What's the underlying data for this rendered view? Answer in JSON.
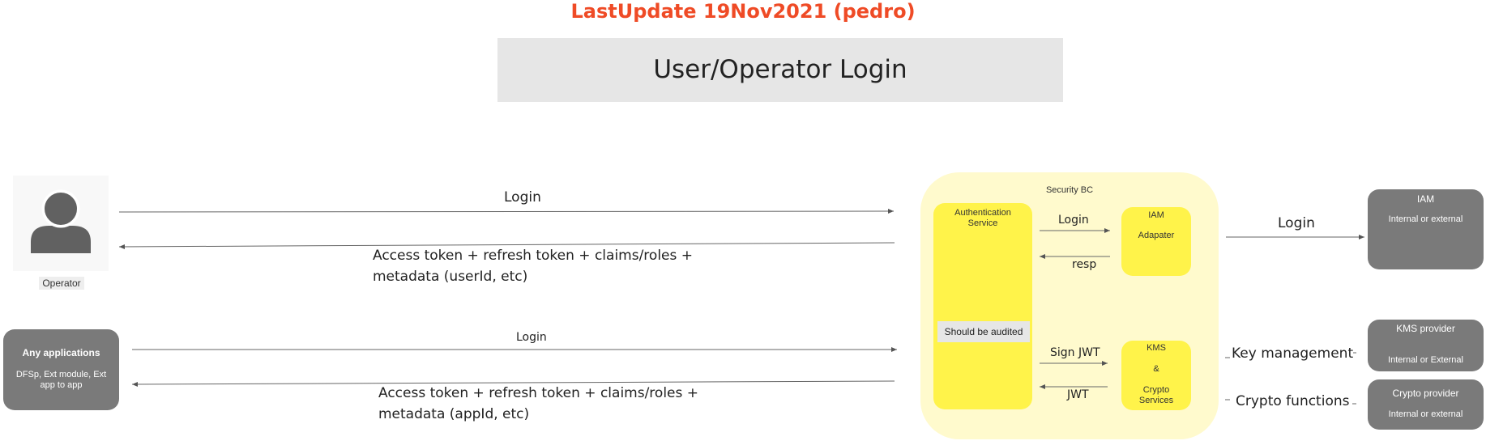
{
  "header": {
    "last_update": "LastUpdate 19Nov2021 (pedro)",
    "title": "User/Operator Login"
  },
  "actors": {
    "operator_label": "Operator",
    "apps_title": "Any applications",
    "apps_desc": "DFSp, Ext module, Ext app to app"
  },
  "security_bc": {
    "title": "Security BC",
    "auth_service": "Authentication Service",
    "audit_note": "Should be audited",
    "iam_adapter_title": "IAM",
    "iam_adapter_sub": "Adapater",
    "kms_title": "KMS",
    "kms_amp": "&",
    "kms_sub": "Crypto Services"
  },
  "external": {
    "iam_title": "IAM",
    "iam_sub": "Internal or external",
    "kms_title": "KMS provider",
    "kms_sub": "Internal or External",
    "crypto_title": "Crypto provider",
    "crypto_sub": "Internal or external"
  },
  "arrows": {
    "operator_login": "Login",
    "operator_response_line1": "Access token + refresh token + claims/roles +",
    "operator_response_line2": "metadata (userId, etc)",
    "apps_login": "Login",
    "apps_response_line1": "Access token + refresh token + claims/roles +",
    "apps_response_line2": "metadata (appId, etc)",
    "inner_login": "Login",
    "inner_resp": "resp",
    "inner_sign": "Sign JWT",
    "inner_jwt": "JWT",
    "iam_login": "Login",
    "key_management": "Key management",
    "crypto_functions": "Crypto functions"
  },
  "colors": {
    "title_accent": "#ef4b26",
    "security_bg": "#fffacd",
    "service_yellow": "#fff34a",
    "external_gray": "#7a7a7a"
  }
}
